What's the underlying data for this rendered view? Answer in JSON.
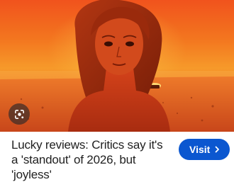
{
  "article": {
    "caption": "Lucky reviews: Critics say it's a 'standout' of 2026, but 'joyless'",
    "visit_label": "Visit"
  },
  "icons": {
    "lens": "google-lens-icon",
    "chevron": "chevron-right-icon"
  },
  "colors": {
    "accent": "#0b57d0",
    "caption_text": "#1f1f1f",
    "image_orange": "#f3761f",
    "image_red": "#c63d14"
  }
}
